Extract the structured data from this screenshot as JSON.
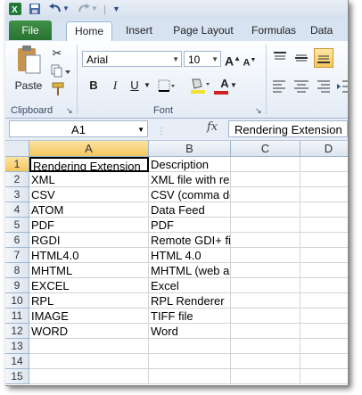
{
  "ribbon_tabs": [
    "File",
    "Home",
    "Insert",
    "Page Layout",
    "Formulas",
    "Data"
  ],
  "clipboard": {
    "paste": "Paste",
    "group": "Clipboard"
  },
  "font": {
    "name": "Arial",
    "size": "10",
    "group": "Font",
    "bold": "B",
    "italic": "I",
    "underline": "U",
    "grow": "A",
    "shrink": "A",
    "font_color": "A"
  },
  "formula_bar": {
    "name_box": "A1",
    "fx": "fx",
    "formula": "Rendering Extension"
  },
  "columns": [
    "A",
    "B",
    "C",
    "D"
  ],
  "rows": [
    "1",
    "2",
    "3",
    "4",
    "5",
    "6",
    "7",
    "8",
    "9",
    "10",
    "11",
    "12",
    "13",
    "14",
    "15"
  ],
  "cells": [
    [
      "Rendering Extension",
      "Description"
    ],
    [
      "XML",
      "XML file with report data"
    ],
    [
      "CSV",
      "CSV (comma delimited)"
    ],
    [
      "ATOM",
      "Data Feed"
    ],
    [
      "PDF",
      "PDF"
    ],
    [
      "RGDI",
      "Remote GDI+ file"
    ],
    [
      "HTML4.0",
      "HTML 4.0"
    ],
    [
      "MHTML",
      "MHTML (web archive)"
    ],
    [
      "EXCEL",
      "Excel"
    ],
    [
      "RPL",
      "RPL Renderer"
    ],
    [
      "IMAGE",
      "TIFF file"
    ],
    [
      "WORD",
      "Word"
    ]
  ],
  "colors": {
    "file_tab": "#2a7332",
    "selected_header": "#f4c65f",
    "gridline": "#d4d4d4"
  }
}
